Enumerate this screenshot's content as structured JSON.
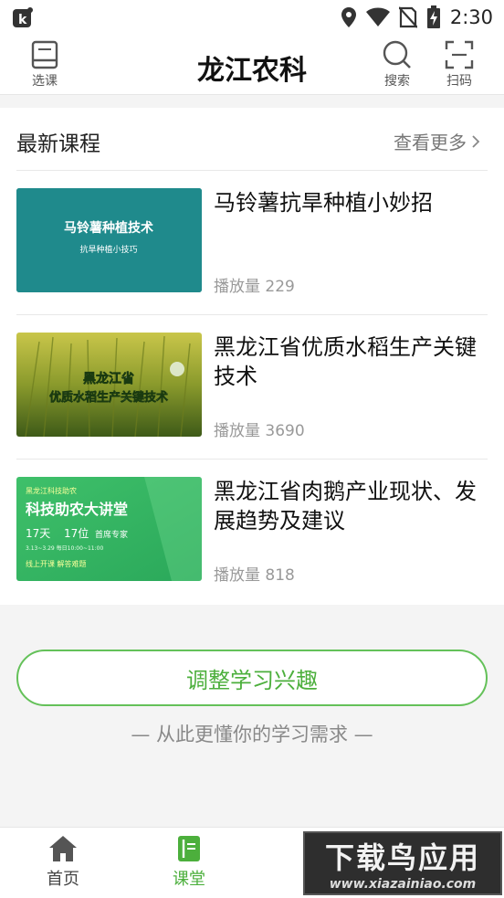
{
  "status_bar": {
    "time": "2:30"
  },
  "header": {
    "left_label": "选课",
    "title": "龙江农科",
    "search_label": "搜索",
    "scan_label": "扫码"
  },
  "section": {
    "title": "最新课程",
    "more": "查看更多"
  },
  "courses": [
    {
      "title": "马铃薯抗旱种植小妙招",
      "plays": "播放量 229",
      "thumb_title": "马铃薯种植技术",
      "thumb_sub": "抗旱种植小技巧"
    },
    {
      "title": "黑龙江省优质水稻生产关键技术",
      "plays": "播放量 3690",
      "thumb_line1": "黑龙江省",
      "thumb_line2": "优质水稻生产关键技术"
    },
    {
      "title": "黑龙江省肉鹅产业现状、发展趋势及建议",
      "plays": "播放量 818",
      "thumb_top": "黑龙江科技助农",
      "thumb_title": "科技助农大讲堂",
      "thumb_days": "17天",
      "thumb_seats": "17位",
      "thumb_experts": "首席专家",
      "thumb_dates": "3.13~3.29 每日10:00~11:00",
      "thumb_bottom": "线上开课  解答难题"
    }
  ],
  "actions": {
    "adjust_label": "调整学习兴趣",
    "caption": "— 从此更懂你的学习需求 —"
  },
  "tabs": [
    {
      "label": "首页",
      "active": false
    },
    {
      "label": "课堂",
      "active": true
    }
  ],
  "watermark": {
    "big": "下载鸟应用",
    "small": "www.xiazainiao.com"
  },
  "colors": {
    "accent": "#4caf3c"
  }
}
